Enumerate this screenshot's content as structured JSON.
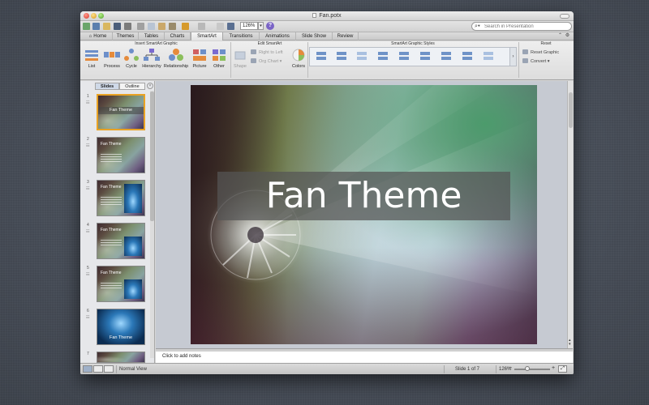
{
  "window": {
    "title": "Fan.potx"
  },
  "toolbar": {
    "zoom_value": "126%",
    "help_glyph": "?",
    "search_placeholder": "Search in Presentation",
    "search_icon": "magnifier-icon"
  },
  "ribbon_tabs": [
    {
      "label": "Home",
      "icon": "home-icon"
    },
    {
      "label": "Themes"
    },
    {
      "label": "Tables"
    },
    {
      "label": "Charts"
    },
    {
      "label": "SmartArt",
      "active": true
    },
    {
      "label": "Transitions"
    },
    {
      "label": "Animations"
    },
    {
      "label": "Slide Show"
    },
    {
      "label": "Review"
    }
  ],
  "ribbon": {
    "groups": {
      "insert": "Insert SmartArt Graphic",
      "edit": "Edit SmartArt",
      "styles": "SmartArt Graphic Styles",
      "reset": "Reset"
    },
    "insert_buttons": [
      "List",
      "Process",
      "Cycle",
      "Hierarchy",
      "Relationship",
      "Picture",
      "Other"
    ],
    "edit": {
      "shape": "Shape",
      "right_to_left": "Right to Left",
      "org_chart": "Org Chart",
      "colors": "Colors"
    },
    "reset": {
      "reset_graphic": "Reset Graphic",
      "convert": "Convert"
    }
  },
  "slides_pane": {
    "tabs": [
      "Slides",
      "Outline"
    ],
    "active_tab": "Slides",
    "thumbnails": [
      {
        "number": "1",
        "title": "Fan Theme",
        "layout": "title",
        "selected": true
      },
      {
        "number": "2",
        "title": "Fan Theme",
        "layout": "content"
      },
      {
        "number": "3",
        "title": "Fan Theme",
        "layout": "photo"
      },
      {
        "number": "4",
        "title": "Fan Theme",
        "layout": "photo"
      },
      {
        "number": "5",
        "title": "Fan Theme",
        "layout": "photo"
      },
      {
        "number": "6",
        "title": "Fan Theme",
        "layout": "band"
      },
      {
        "number": "7",
        "title": "",
        "layout": "blank"
      }
    ]
  },
  "slide": {
    "title": "Fan Theme"
  },
  "notes": {
    "placeholder": "Click to add notes"
  },
  "statusbar": {
    "view_mode": "Normal View",
    "slide_counter": "Slide 1 of 7",
    "zoom": "126%",
    "zoom_minus": "−",
    "zoom_plus": "+"
  },
  "colors": {
    "accent_selection": "#e9a224",
    "active_tab": "#f6f6f6",
    "help_icon": "#7a64c6"
  }
}
